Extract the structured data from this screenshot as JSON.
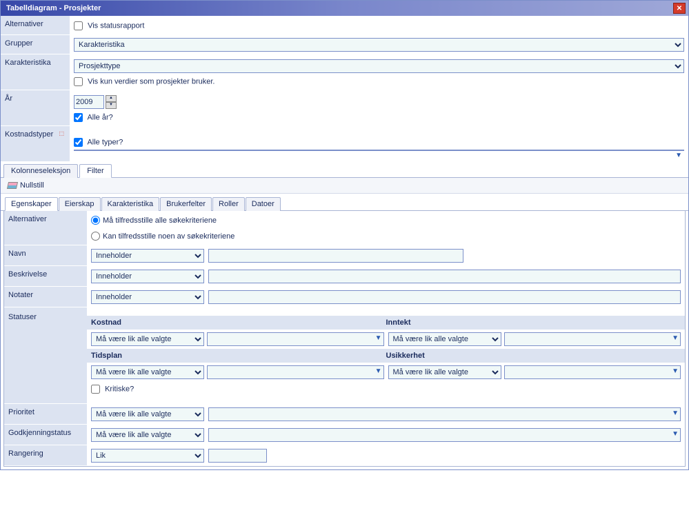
{
  "window": {
    "title": "Tabelldiagram - Prosjekter"
  },
  "top_form": {
    "alternativer": {
      "label": "Alternativer",
      "vis_statusrapport": "Vis statusrapport"
    },
    "grupper": {
      "label": "Grupper",
      "value": "Karakteristika"
    },
    "karakteristika": {
      "label": "Karakteristika",
      "value": "Prosjekttype",
      "vis_kun": "Vis kun verdier som prosjekter bruker."
    },
    "aar": {
      "label": "År",
      "value": "2009",
      "alle_aar": "Alle år?"
    },
    "kostnadstyper": {
      "label": "Kostnadstyper",
      "alle_typer": "Alle typer?"
    }
  },
  "tabs": {
    "kolonne": "Kolonneseleksjon",
    "filter": "Filter"
  },
  "toolbar": {
    "nullstill": "Nullstill"
  },
  "sub_tabs": {
    "egenskaper": "Egenskaper",
    "eierskap": "Eierskap",
    "karakteristika": "Karakteristika",
    "brukerfelter": "Brukerfelter",
    "roller": "Roller",
    "datoer": "Datoer"
  },
  "filter": {
    "alternativer": {
      "label": "Alternativer",
      "alle": "Må tilfredsstille alle søkekriteriene",
      "noen": "Kan tilfredsstille noen av søkekriteriene"
    },
    "navn": {
      "label": "Navn",
      "op": "Inneholder"
    },
    "beskrivelse": {
      "label": "Beskrivelse",
      "op": "Inneholder"
    },
    "notater": {
      "label": "Notater",
      "op": "Inneholder"
    },
    "statuser": {
      "label": "Statuser",
      "kostnad": "Kostnad",
      "inntekt": "Inntekt",
      "tidsplan": "Tidsplan",
      "usikkerhet": "Usikkerhet",
      "op": "Må være lik alle valgte",
      "kritiske": "Kritiske?"
    },
    "prioritet": {
      "label": "Prioritet",
      "op": "Må være lik alle valgte"
    },
    "godkjenning": {
      "label": "Godkjenningstatus",
      "op": "Må være lik alle valgte"
    },
    "rangering": {
      "label": "Rangering",
      "op": "Lik"
    }
  }
}
